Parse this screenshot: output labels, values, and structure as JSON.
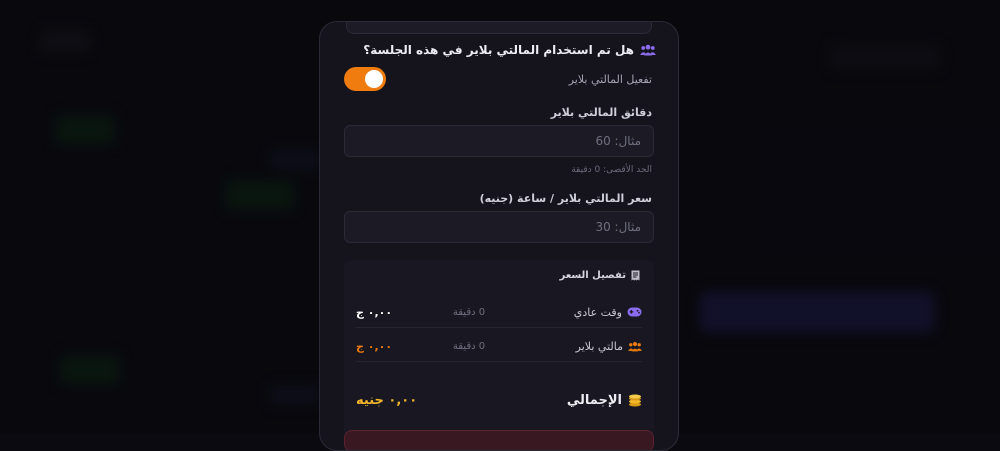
{
  "question": {
    "title": "هل تم استخدام المالتي بلاير في هذه الجلسة؟",
    "icon": "users-icon"
  },
  "toggle": {
    "label": "تفعيل المالتي بلاير",
    "on": true,
    "color": "#f07b0e"
  },
  "minutes_field": {
    "label": "دقائق المالتي بلاير",
    "placeholder": "مثال: 60",
    "hint": "الحد الأقصى: 0 دقيقة"
  },
  "price_field": {
    "label": "سعر المالتي بلاير / ساعة (جنيه)",
    "placeholder": "مثال: 30"
  },
  "breakdown": {
    "title": "تفصيل السعر",
    "icon": "receipt-icon",
    "rows": [
      {
        "name": "وقت عادي",
        "minutes": "0 دقيقة",
        "amount": "٠,٠٠ ج",
        "icon": "gamepad-icon",
        "amount_color": "#ffffff"
      },
      {
        "name": "مالتي بلاير",
        "minutes": "0 دقيقة",
        "amount": "٠,٠٠ ج",
        "icon": "users-icon",
        "amount_color": "#f07b0e"
      }
    ],
    "total_label": "الإجمالي",
    "total_amount": "٠,٠٠ جنيه",
    "total_icon": "coins-icon",
    "total_color": "#f5b82a"
  },
  "colors": {
    "accent_purple": "#8b6cf0",
    "accent_orange": "#f07b0e",
    "gold": "#f5b82a"
  }
}
